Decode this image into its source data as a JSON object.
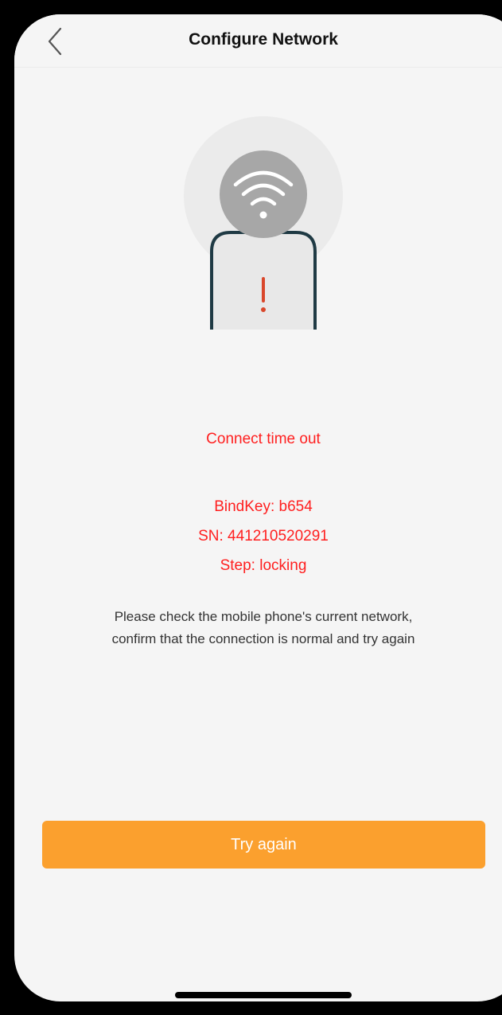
{
  "nav": {
    "title": "Configure Network",
    "back_icon": "chevron-left-icon"
  },
  "illustration": {
    "icons": [
      "wifi-icon",
      "phone-icon",
      "exclamation-icon"
    ],
    "accent_color": "#d9472b",
    "phone_outline_color": "#1f3a44"
  },
  "status": {
    "message": "Connect time out",
    "bind_key": "BindKey: b654",
    "sn": "SN: 441210520291",
    "step": "Step: locking",
    "color": "#ff1f1f"
  },
  "hint": {
    "line1": "Please check the mobile phone's current network,",
    "line2": "confirm that the connection is normal and try again"
  },
  "actions": {
    "try_again_label": "Try again",
    "button_color": "#fba02e"
  }
}
